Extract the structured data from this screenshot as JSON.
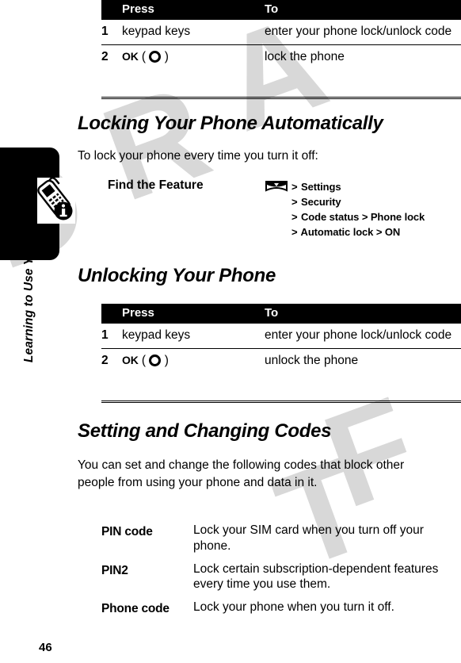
{
  "page": {
    "number": "46",
    "running_head": "Learning to Use Your Phone",
    "watermark_text": "DRAFT"
  },
  "icons": {
    "phone_info": "phone-info-icon",
    "menu_key": "menu-key-icon",
    "select_key": "select-ring-icon"
  },
  "lock_table": {
    "headers": {
      "num": "",
      "press": "Press",
      "to": "To"
    },
    "rows": [
      {
        "num": "1",
        "press": "keypad keys",
        "to": "enter your phone lock/unlock code"
      },
      {
        "num": "2",
        "press": "OK",
        "press_suffix_open": "(",
        "press_suffix_close": ")",
        "to": "lock the phone"
      }
    ]
  },
  "auto_lock": {
    "heading": "Locking Your Phone Automatically",
    "intro": "To lock your phone every time you turn it off:",
    "find_feature_label": "Find the Feature",
    "path_rows": [
      {
        "prefix": "",
        "gt": ">",
        "items": "Settings"
      },
      {
        "prefix": "",
        "gt": ">",
        "items": "Security"
      },
      {
        "prefix": "",
        "gt": ">",
        "items": "Code status >  Phone lock"
      },
      {
        "prefix": "",
        "gt": ">",
        "items": "Automatic lock >  ON"
      }
    ]
  },
  "unlock": {
    "heading": "Unlocking Your Phone",
    "table": {
      "headers": {
        "num": "",
        "press": "Press",
        "to": "To"
      },
      "rows": [
        {
          "num": "1",
          "press": "keypad keys",
          "to": "enter your phone lock/unlock code"
        },
        {
          "num": "2",
          "press": "OK",
          "press_suffix_open": "(",
          "press_suffix_close": ")",
          "to": "unlock the phone"
        }
      ]
    }
  },
  "codes": {
    "heading": "Setting and Changing Codes",
    "intro": "You can set and change the following codes that block other people from using your phone and data in it.",
    "entries": [
      {
        "term": "PIN code",
        "desc": "Lock your SIM card when you turn off your phone."
      },
      {
        "term": "PIN2",
        "desc": "Lock certain subscription-dependent features every time you use them."
      },
      {
        "term": "Phone code",
        "desc": "Lock your phone when you turn it off."
      }
    ]
  }
}
